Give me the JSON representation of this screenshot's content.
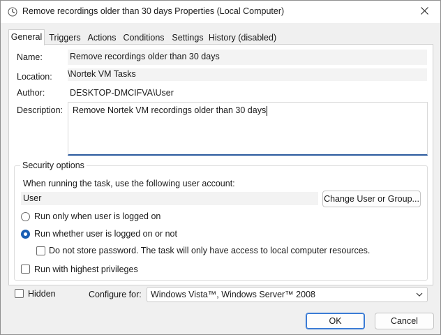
{
  "window": {
    "title": "Remove recordings older than 30 days Properties (Local Computer)"
  },
  "tabs": [
    {
      "label": "General"
    },
    {
      "label": "Triggers"
    },
    {
      "label": "Actions"
    },
    {
      "label": "Conditions"
    },
    {
      "label": "Settings"
    },
    {
      "label": "History (disabled)"
    }
  ],
  "general": {
    "name_label": "Name:",
    "name_value": "Remove recordings older than 30 days",
    "location_label": "Location:",
    "location_value": "\\Nortek VM Tasks",
    "author_label": "Author:",
    "author_value": "DESKTOP-DMCIFVA\\User",
    "description_label": "Description:",
    "description_value": "Remove Nortek VM recordings older than 30 days"
  },
  "security": {
    "group_label": "Security options",
    "account_prompt": "When running the task, use the following user account:",
    "account_value": "User",
    "change_button": "Change User or Group...",
    "radio_logged_on": "Run only when user is logged on",
    "radio_whether": "Run whether user is logged on or not",
    "no_store_password": "Do not store password.  The task will only have access to local computer resources.",
    "highest_privileges": "Run with highest privileges"
  },
  "footer": {
    "hidden_label": "Hidden",
    "configure_label": "Configure for:",
    "configure_value": "Windows Vista™, Windows Server™ 2008",
    "ok_button": "OK",
    "cancel_button": "Cancel"
  },
  "icons": {
    "app": "clock-icon",
    "close": "close-icon",
    "dropdown": "chevron-down-icon"
  },
  "colors": {
    "accent": "#1a5fb4",
    "focus_border": "#3a7bd5"
  }
}
